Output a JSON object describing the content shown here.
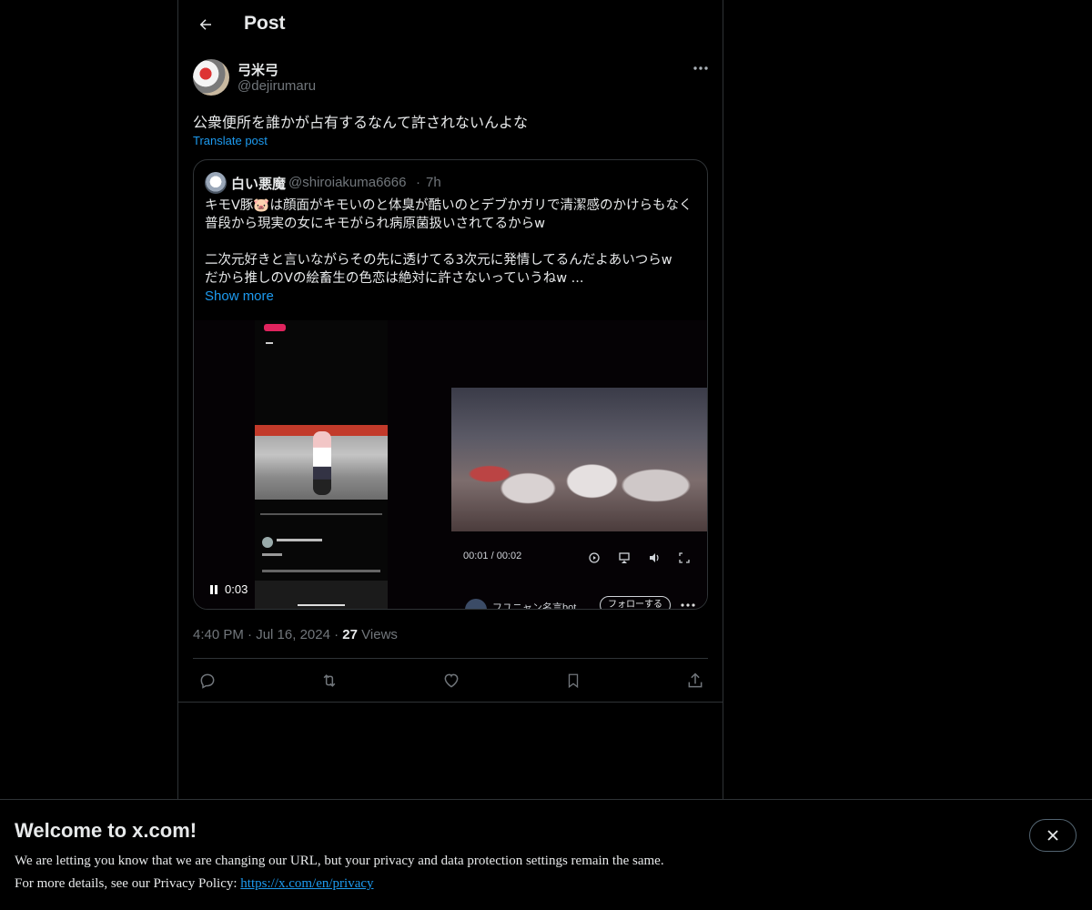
{
  "header": {
    "title": "Post",
    "back_icon": "arrow-left-icon"
  },
  "post": {
    "display_name": "弓米弓",
    "handle": "@dejirumaru",
    "text": "公衆便所を誰かが占有するなんて許されないんよな",
    "translate_label": "Translate post",
    "timestamp_time": "4:40 PM",
    "timestamp_date": "Jul 16, 2024",
    "views_count": "27",
    "views_label": "Views",
    "separator": "·"
  },
  "quote": {
    "display_name": "白い悪魔",
    "handle": "@shiroiakuma6666",
    "separator": "·",
    "time": "7h",
    "text": "キモV豚🐷は顔面がキモいのと体臭が酷いのとデブかガリで清潔感のかけらもなく普段から現実の女にキモがられ病原菌扱いされてるからw\n\n二次元好きと言いながらその先に透けてる3次元に発情してるんだよあいつらw\nだから推しのVの絵畜生の色恋は絶対に許さないっていうねw ...",
    "show_more": "Show more",
    "video_overlay_time": "0:03",
    "embedded_video_time": "00:01 / 00:02",
    "embedded_account_name": "フユニャン名言bot",
    "embedded_follow_label": "フォローする"
  },
  "actions": {
    "reply_icon": "reply-icon",
    "repost_icon": "repost-icon",
    "like_icon": "heart-icon",
    "bookmark_icon": "bookmark-icon",
    "share_icon": "share-icon"
  },
  "banner": {
    "title": "Welcome to x.com!",
    "line1": "We are letting you know that we are changing our URL, but your privacy and data protection settings remain the same.",
    "line2_prefix": "For more details, see our Privacy Policy: ",
    "line2_link": "https://x.com/en/privacy"
  },
  "colors": {
    "background": "#000000",
    "link": "#1d9bf0",
    "muted": "#71767b",
    "border": "#2f3336"
  }
}
